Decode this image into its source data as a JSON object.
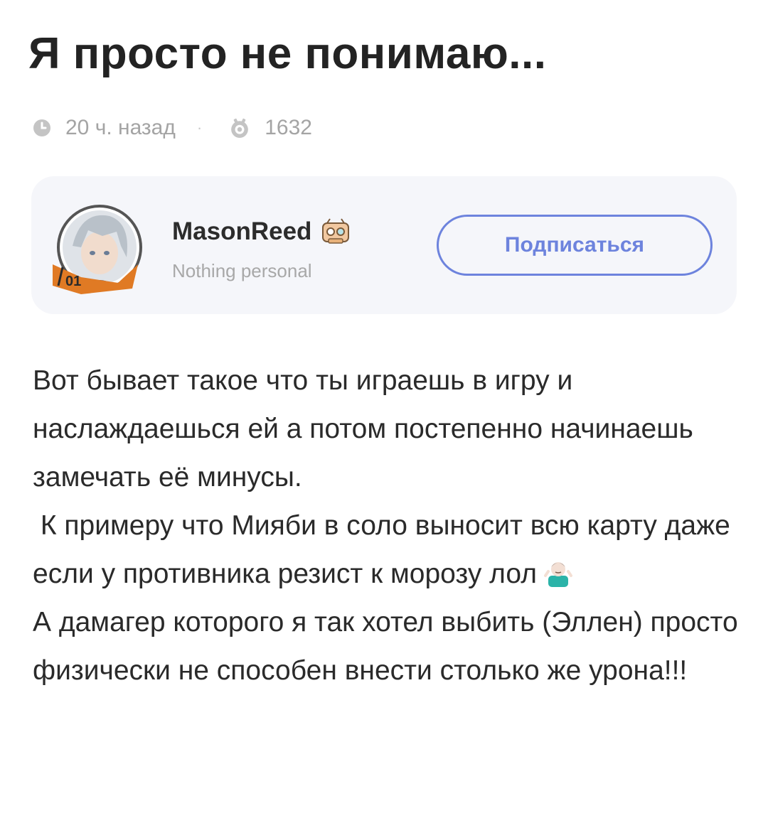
{
  "post": {
    "title": "Я просто не понимаю...",
    "time_ago": "20 ч. назад",
    "separator": "·",
    "views": "1632"
  },
  "author": {
    "name": "MasonReed",
    "signature": "Nothing personal",
    "avatar_frame_text": "01",
    "subscribe_label": "Подписаться"
  },
  "body": {
    "lines": [
      "Вот бывает такое что ты играешь в игру и наслаждаешься ей а потом постепенно начинаешь замечать её минусы.",
      " К примеру что Мияби в соло выносит всю карту даже если у противника резист к морозу лол",
      "А дамагер которого я так хотел выбить (Эллен) просто физически не способен внести столько же урона!!!"
    ],
    "emoji": "shrug-man-emoji"
  },
  "colors": {
    "accent": "#6d83dd",
    "card_bg": "#f5f6fa",
    "meta_text": "#a4a4a4"
  }
}
